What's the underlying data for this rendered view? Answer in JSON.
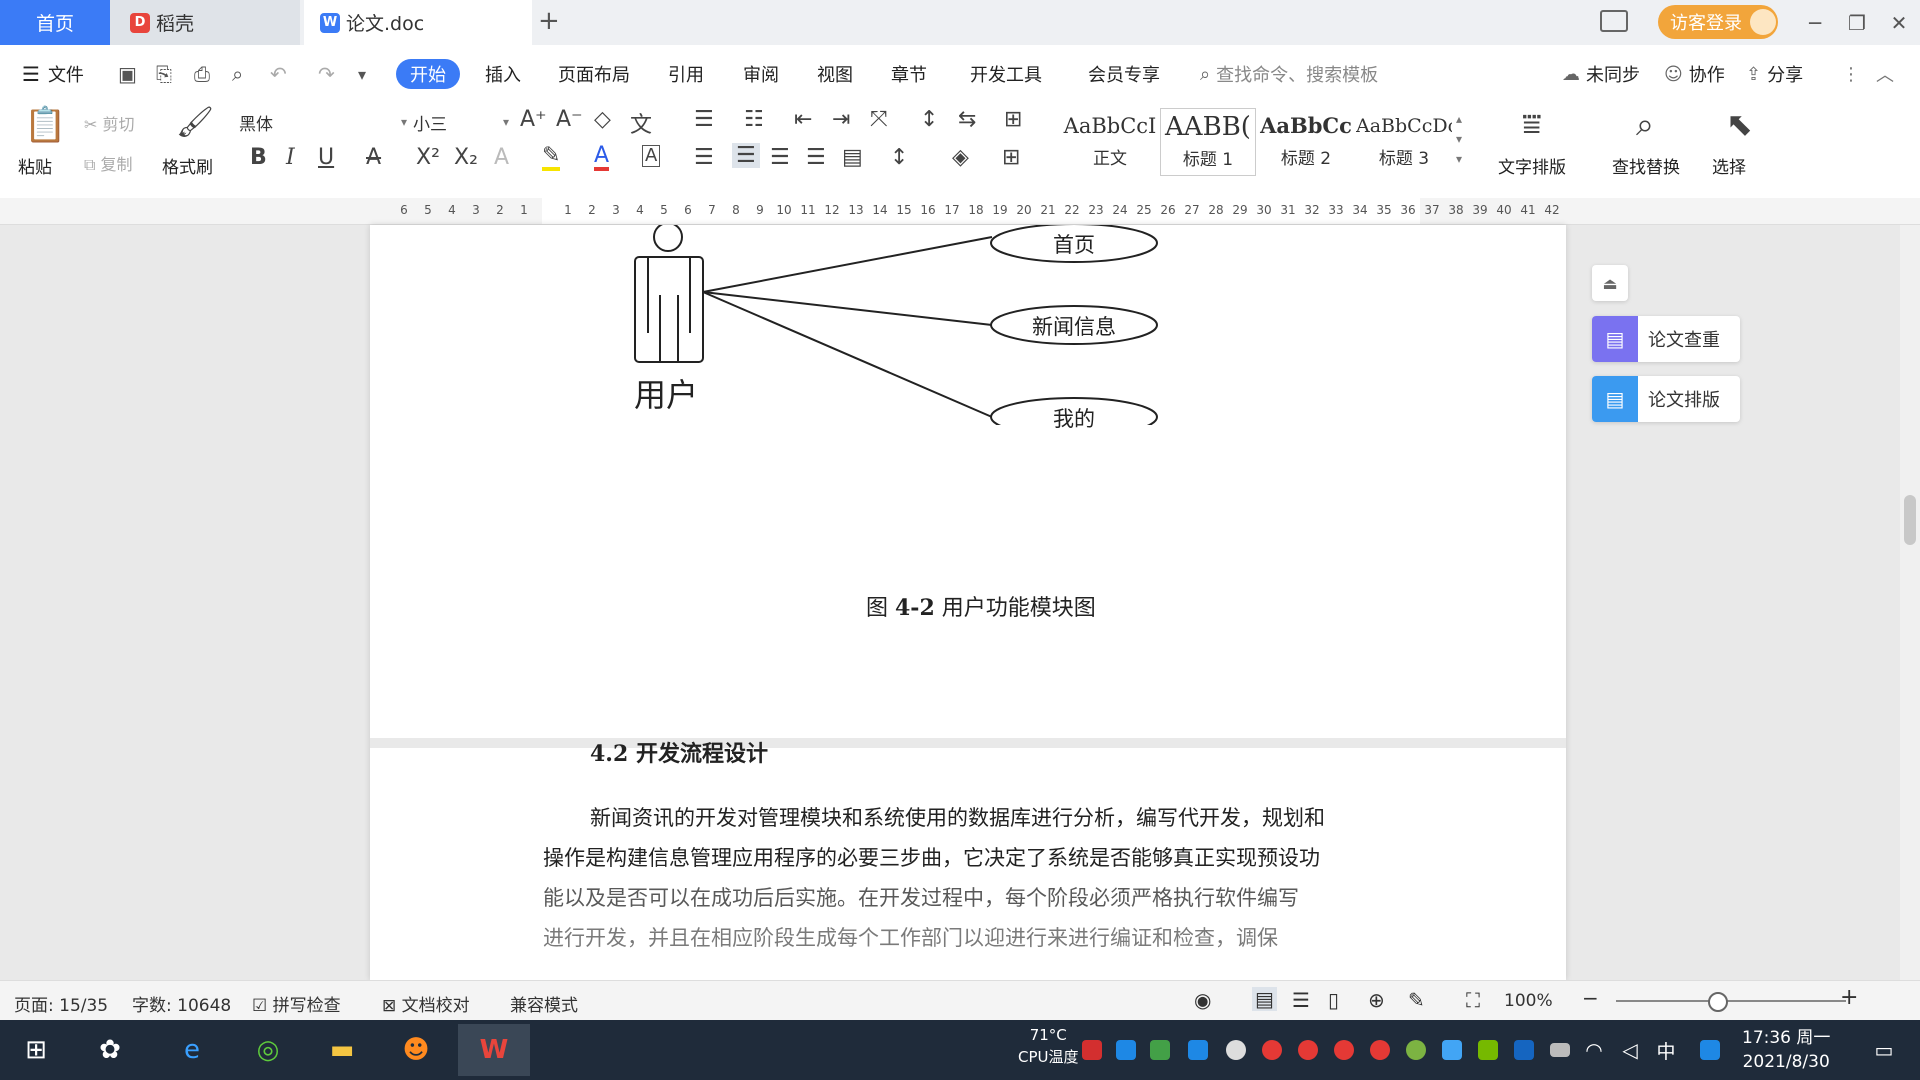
{
  "tabs": {
    "home": "首页",
    "daoke": "稻壳",
    "doc": "论文.doc",
    "new_tab": "+"
  },
  "header": {
    "login": "访客登录"
  },
  "menu": {
    "file": "文件",
    "items": [
      "开始",
      "插入",
      "页面布局",
      "引用",
      "审阅",
      "视图",
      "章节",
      "开发工具",
      "会员专享"
    ],
    "search_placeholder": "查找命令、搜索模板",
    "unsynced": "未同步",
    "collab": "协作",
    "share": "分享"
  },
  "ribbon": {
    "paste": "粘贴",
    "cut": "剪切",
    "copy": "复制",
    "format_painter": "格式刷",
    "font": "黑体",
    "size": "小三",
    "styles": [
      {
        "preview": "AaBbCcI",
        "label": "正文"
      },
      {
        "preview": "AABB(",
        "label": "标题 1"
      },
      {
        "preview": "AaBbCc",
        "label": "标题 2"
      },
      {
        "preview": "AaBbCcDc",
        "label": "标题 3"
      }
    ],
    "text_layout": "文字排版",
    "find_replace": "查找替换",
    "select": "选择"
  },
  "ruler": {
    "left_numbers": [
      "6",
      "5",
      "4",
      "3",
      "2",
      "1"
    ],
    "right_numbers": [
      "1",
      "2",
      "3",
      "4",
      "5",
      "6",
      "7",
      "8",
      "9",
      "10",
      "11",
      "12",
      "13",
      "14",
      "15",
      "16",
      "17",
      "18",
      "19",
      "20",
      "21",
      "22",
      "23",
      "24",
      "25",
      "26",
      "27",
      "28",
      "29",
      "30",
      "31",
      "32",
      "33",
      "34",
      "35",
      "36",
      "37",
      "38",
      "39",
      "40",
      "41",
      "42"
    ]
  },
  "diagram": {
    "actor": "用户",
    "use_cases": [
      "首页",
      "新闻信息",
      "我的"
    ]
  },
  "document": {
    "figure_caption_prefix": "图 ",
    "figure_caption_number": "4-2",
    "figure_caption_text": " 用户功能模块图",
    "section_number": "4.2",
    "section_title": " 开发流程设计",
    "paragraph_line1": "新闻资讯的开发对管理模块和系统使用的数据库进行分析，编写代开发，规划和",
    "paragraph_line2": "操作是构建信息管理应用程序的必要三步曲，它决定了系统是否能够真正实现预设功",
    "paragraph_line3": "能以及是否可以在成功后后实施。在开发过程中，每个阶段必须严格执行软件编写",
    "paragraph_line4": "进行开发，并且在相应阶段生成每个工作部门以迎进行来进行编证和检查，调保"
  },
  "side_panel": {
    "check": "论文查重",
    "layout": "论文排版"
  },
  "status": {
    "page": "页面: 15/35",
    "words": "字数: 10648",
    "spell": "拼写检查",
    "proof": "文档校对",
    "compat": "兼容模式",
    "zoom": "100%"
  },
  "taskbar": {
    "temp": "71°C",
    "cpu": "CPU温度",
    "ime": "中",
    "time": "17:36 周一",
    "date": "2021/8/30"
  },
  "colors": {
    "accent": "#3b7bf6",
    "login": "#f2a53b",
    "taskbar": "#1f2b3a"
  }
}
